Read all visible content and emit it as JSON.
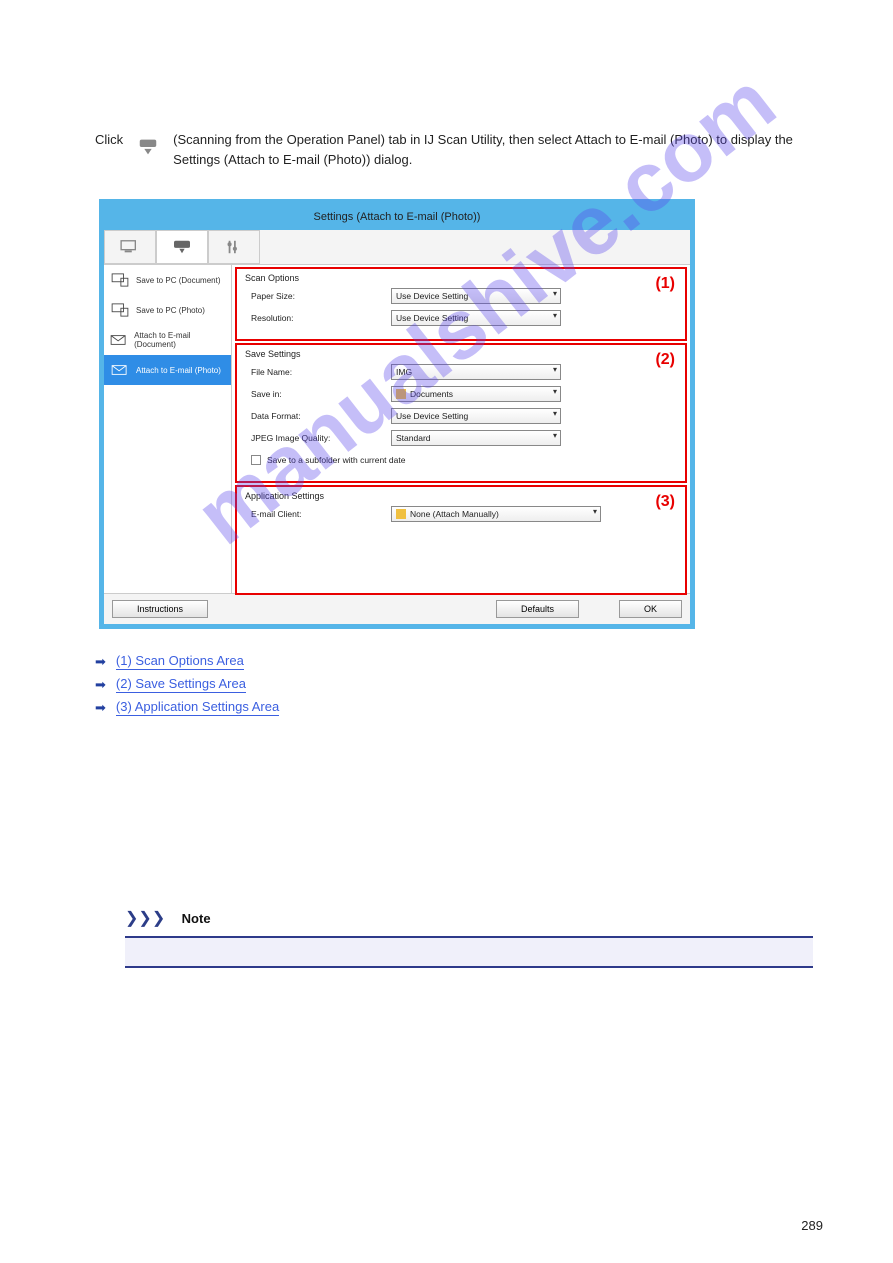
{
  "intro_text": "(Scanning from the Operation Panel) tab in IJ Scan Utility, then select Attach to E-mail (Photo) to display the Settings (Attach to E-mail (Photo)) dialog.",
  "dialog": {
    "title": "Settings (Attach to E-mail (Photo))"
  },
  "sidebar": {
    "items": [
      {
        "label": "Save to PC (Document)"
      },
      {
        "label": "Save to PC (Photo)"
      },
      {
        "label": "Attach to E-mail (Document)"
      },
      {
        "label": "Attach to E-mail (Photo)"
      }
    ]
  },
  "sections": {
    "scan_options": {
      "title": "Scan Options",
      "num": "(1)",
      "paper_size_label": "Paper Size:",
      "paper_size_value": "Use Device Setting",
      "resolution_label": "Resolution:",
      "resolution_value": "Use Device Setting"
    },
    "save_settings": {
      "title": "Save Settings",
      "num": "(2)",
      "file_name_label": "File Name:",
      "file_name_value": "IMG",
      "save_in_label": "Save in:",
      "save_in_value": "Documents",
      "data_format_label": "Data Format:",
      "data_format_value": "Use Device Setting",
      "jpeg_quality_label": "JPEG Image Quality:",
      "jpeg_quality_value": "Standard",
      "subfolder_label": "Save to a subfolder with current date"
    },
    "application_settings": {
      "title": "Application Settings",
      "num": "(3)",
      "email_client_label": "E-mail Client:",
      "email_client_value": "None (Attach Manually)"
    }
  },
  "footer": {
    "instructions": "Instructions",
    "defaults": "Defaults",
    "ok": "OK"
  },
  "arrow_links": {
    "a": "(1) Scan Options Area",
    "b": "(2) Save Settings Area",
    "c": "(3) Application Settings Area"
  },
  "note": {
    "header": "Note"
  },
  "watermark": "manualshive.com",
  "page_number": "289"
}
